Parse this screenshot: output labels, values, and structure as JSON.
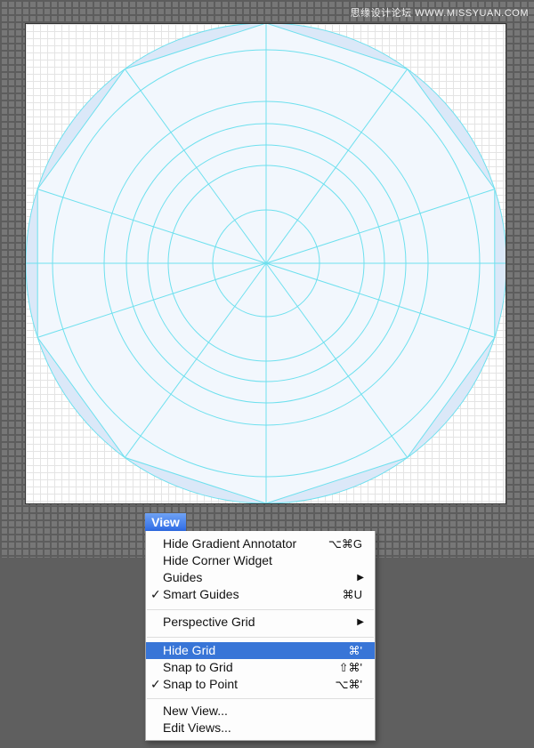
{
  "watermark": "思缘设计论坛 WWW.MISSYUAN.COM",
  "menu": {
    "title": "View",
    "items": [
      {
        "label": "Hide Gradient Annotator",
        "shortcut": "⌥⌘G",
        "checked": false,
        "submenu": false,
        "highlighted": false
      },
      {
        "label": "Hide Corner Widget",
        "shortcut": "",
        "checked": false,
        "submenu": false,
        "highlighted": false
      },
      {
        "label": "Guides",
        "shortcut": "",
        "checked": false,
        "submenu": true,
        "highlighted": false
      },
      {
        "label": "Smart Guides",
        "shortcut": "⌘U",
        "checked": true,
        "submenu": false,
        "highlighted": false
      },
      {
        "label": "Perspective Grid",
        "shortcut": "",
        "checked": false,
        "submenu": true,
        "highlighted": false
      },
      {
        "label": "Hide Grid",
        "shortcut": "⌘'",
        "checked": false,
        "submenu": false,
        "highlighted": true
      },
      {
        "label": "Snap to Grid",
        "shortcut": "⇧⌘'",
        "checked": false,
        "submenu": false,
        "highlighted": false
      },
      {
        "label": "Snap to Point",
        "shortcut": "⌥⌘'",
        "checked": true,
        "submenu": false,
        "highlighted": false
      },
      {
        "label": "New View...",
        "shortcut": "",
        "checked": false,
        "submenu": false,
        "highlighted": false
      },
      {
        "label": "Edit Views...",
        "shortcut": "",
        "checked": false,
        "submenu": false,
        "highlighted": false
      }
    ],
    "check_glyph": "✓",
    "arrow_glyph": "▶"
  },
  "colors": {
    "guide": "#6ee0ee",
    "shape_fill": "#dbe8f8",
    "menu_highlight": "#3875d7"
  },
  "canvas": {
    "ring_count": 5,
    "spoke_count": 10,
    "polygon_sides": 10
  }
}
